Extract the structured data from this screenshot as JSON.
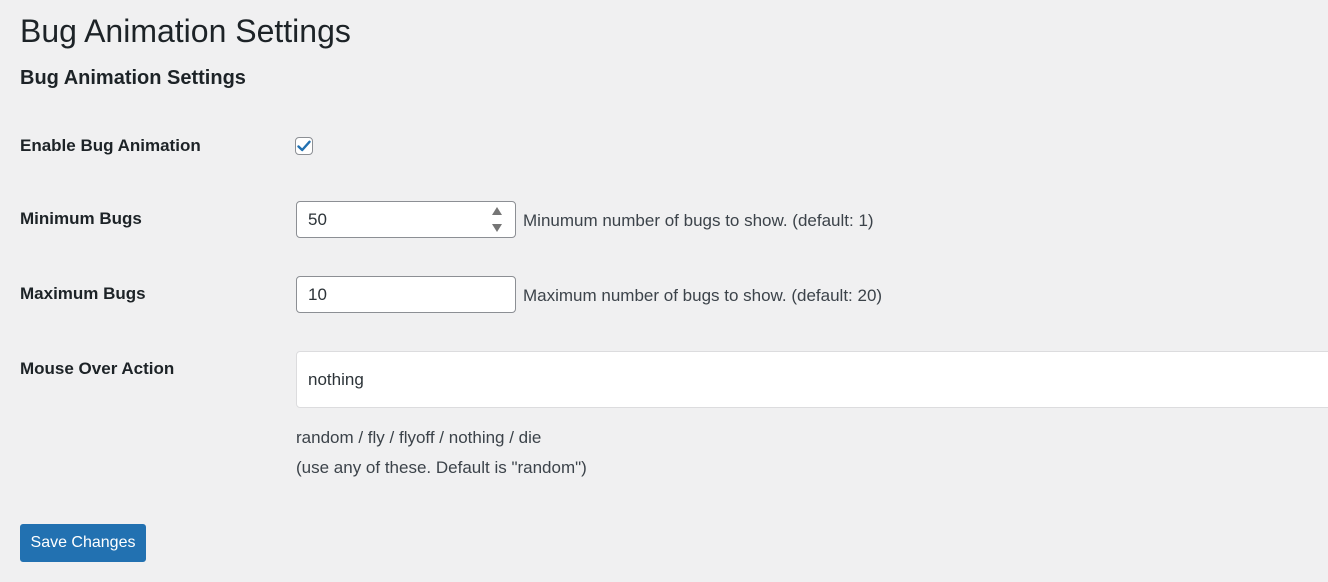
{
  "page": {
    "title": "Bug Animation Settings",
    "section_title": "Bug Animation Settings"
  },
  "fields": {
    "enable": {
      "label": "Enable Bug Animation",
      "checked": true
    },
    "min_bugs": {
      "label": "Minimum Bugs",
      "value": "50",
      "description": "Minumum number of bugs to show. (default: 1)"
    },
    "max_bugs": {
      "label": "Maximum Bugs",
      "value": "10",
      "description": "Maximum number of bugs to show. (default: 20)"
    },
    "mouse_over": {
      "label": "Mouse Over Action",
      "value": "nothing",
      "help_line1": "random / fly / flyoff / nothing / die",
      "help_line2": "(use any of these. Default is \"random\")"
    }
  },
  "actions": {
    "save_label": "Save Changes"
  },
  "colors": {
    "background": "#f0f0f1",
    "primary_button": "#2271b1",
    "checkmark": "#2271b1"
  },
  "icons": {
    "checkbox": "checkmark-icon",
    "spinner": "number-spinner-icon"
  }
}
